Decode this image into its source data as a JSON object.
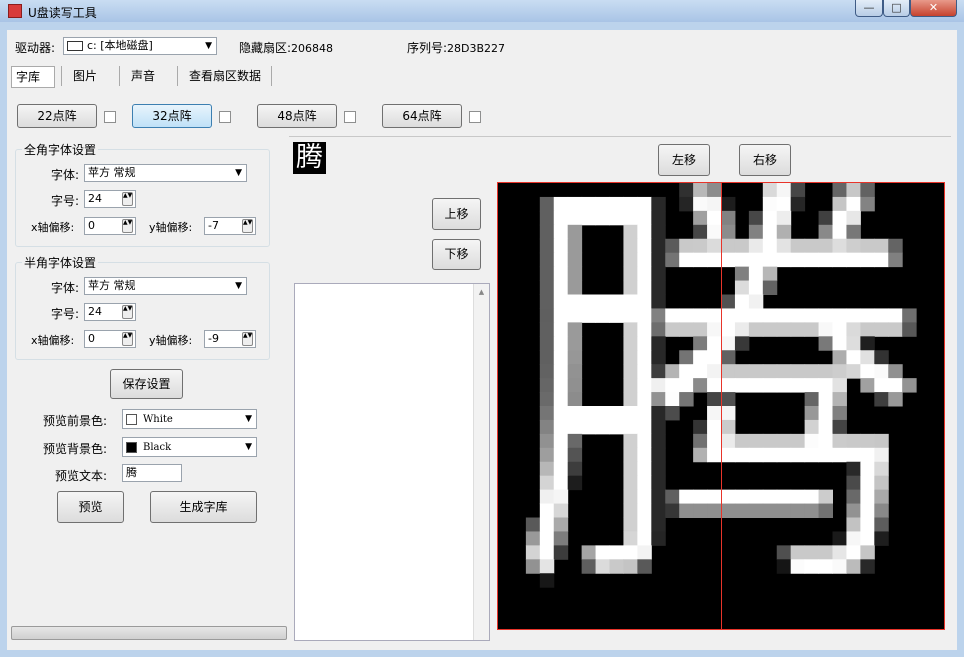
{
  "window": {
    "title": "U盘读写工具",
    "min": "—",
    "max": "□",
    "close": "✕"
  },
  "toolbar": {
    "drive_label": "驱动器:",
    "drive_value": "c: [本地磁盘]",
    "hidden_sector_label": "隐藏扇区:",
    "hidden_sector_value": "206848",
    "serial_label": "序列号:",
    "serial_value": "28D3B227"
  },
  "tabs": [
    {
      "label": "字库"
    },
    {
      "label": "图片"
    },
    {
      "label": "声音"
    },
    {
      "label": "查看扇区数据"
    }
  ],
  "matrix_buttons": [
    {
      "label": "22点阵"
    },
    {
      "label": "32点阵"
    },
    {
      "label": "48点阵"
    },
    {
      "label": "64点阵"
    }
  ],
  "fullwidth": {
    "group_title": "全角字体设置",
    "font_label": "字体:",
    "font_value": "苹方 常规",
    "size_label": "字号:",
    "size_value": "24",
    "xoff_label": "x轴偏移:",
    "xoff_value": "0",
    "yoff_label": "y轴偏移:",
    "yoff_value": "-7"
  },
  "halfwidth": {
    "group_title": "半角字体设置",
    "font_label": "字体:",
    "font_value": "苹方 常规",
    "size_label": "字号:",
    "size_value": "24",
    "xoff_label": "x轴偏移:",
    "xoff_value": "0",
    "yoff_label": "y轴偏移:",
    "yoff_value": "-9"
  },
  "save_button": "保存设置",
  "fg": {
    "label": "预览前景色:",
    "value": "White",
    "color": "#ffffff"
  },
  "bg": {
    "label": "预览背景色:",
    "value": "Black",
    "color": "#000000"
  },
  "preview_text": {
    "label": "预览文本:",
    "value": "腾"
  },
  "preview_button": "预览",
  "generate_button": "生成字库",
  "small_glyph": "腾",
  "move": {
    "left": "左移",
    "right": "右移",
    "up": "上移",
    "down": "下移"
  },
  "canvas": {
    "glyph": "腾",
    "fg": "#ffffff",
    "bg": "#000000",
    "guide_color": "#e8342a",
    "grid": 32
  }
}
